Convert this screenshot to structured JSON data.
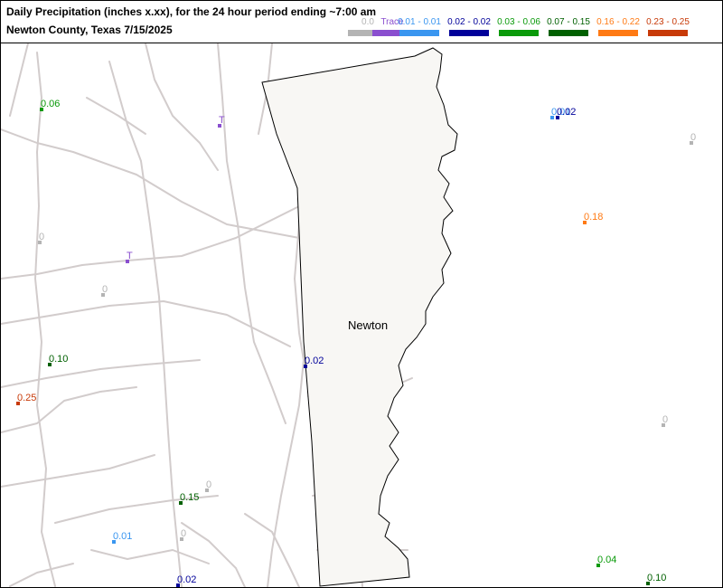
{
  "header": {
    "title_line1": "Daily Precipitation (inches  x.xx),  for the 24 hour period ending ~7:00 am",
    "title_line2": "Newton County, Texas  7/15/2025"
  },
  "legend": [
    {
      "label": "0.0",
      "color": "#b4b4b4",
      "label_color": "#b4b4b4"
    },
    {
      "label": "Trace",
      "color": "#8a4fcf",
      "label_color": "#8a4fcf"
    },
    {
      "label": "0.01 - 0.01",
      "color": "#3a96f0",
      "label_color": "#3a96f0"
    },
    {
      "label": "0.02 - 0.02",
      "color": "#00009a",
      "label_color": "#00009a"
    },
    {
      "label": "0.03 - 0.06",
      "color": "#0a9a0a",
      "label_color": "#0a9a0a"
    },
    {
      "label": "0.07 - 0.15",
      "color": "#006000",
      "label_color": "#006000"
    },
    {
      "label": "0.16 - 0.22",
      "color": "#ff7a14",
      "label_color": "#ff7a14"
    },
    {
      "label": "0.23 - 0.25",
      "color": "#c83a08",
      "label_color": "#c83a08"
    }
  ],
  "map": {
    "county_name": "Newton",
    "county_fill": "#f8f7f4",
    "road_color": "#d2cccc",
    "stations": [
      {
        "label": "0.06",
        "category": 4
      },
      {
        "label": "T",
        "category": 1
      },
      {
        "label": "0",
        "category": 0
      },
      {
        "label": "T",
        "category": 1
      },
      {
        "label": "0",
        "category": 0
      },
      {
        "label": "0.10",
        "category": 5
      },
      {
        "label": "0.25",
        "category": 7
      },
      {
        "label": "0.02",
        "category": 3
      },
      {
        "label": "0",
        "category": 0
      },
      {
        "label": "0.15",
        "category": 5
      },
      {
        "label": "0.01",
        "category": 2
      },
      {
        "label": "0",
        "category": 0
      },
      {
        "label": "0.02",
        "category": 3
      },
      {
        "label": "0.01",
        "category": 2
      },
      {
        "label": "0.02",
        "category": 3
      },
      {
        "label": "0",
        "category": 0
      },
      {
        "label": "0.18",
        "category": 6
      },
      {
        "label": "0",
        "category": 0
      },
      {
        "label": "0.04",
        "category": 4
      },
      {
        "label": "0.10",
        "category": 5
      }
    ]
  }
}
